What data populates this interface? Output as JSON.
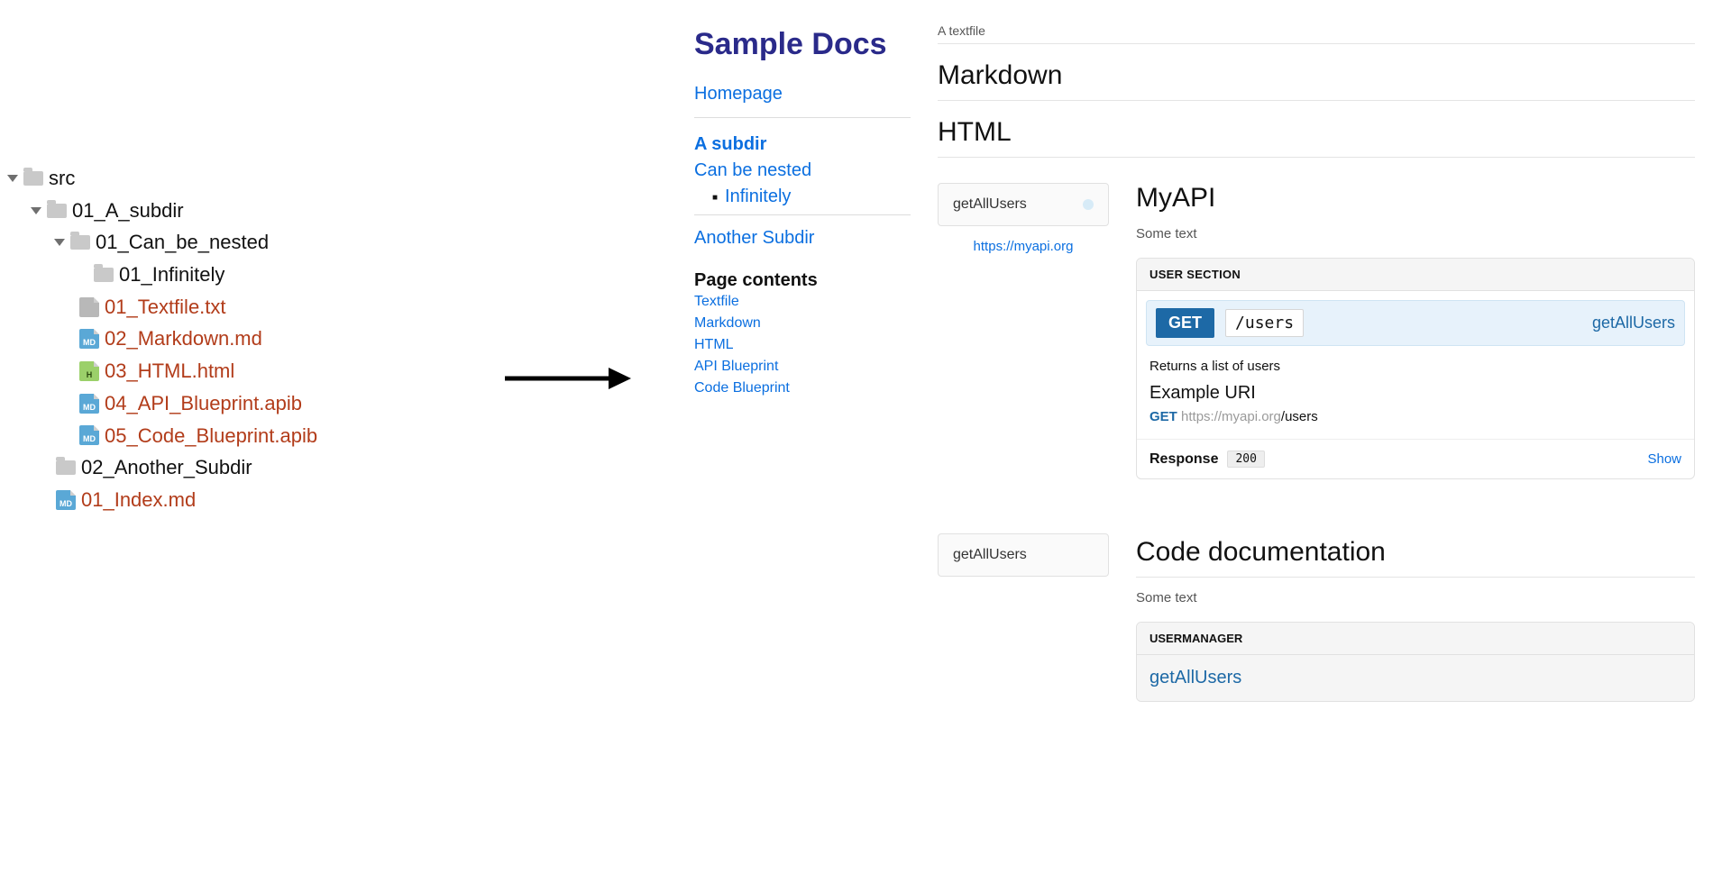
{
  "filetree": {
    "root": "src",
    "subdir": "01_A_subdir",
    "nested": "01_Can_be_nested",
    "infinitely": "01_Infinitely",
    "files_nested": [
      {
        "name": "01_Textfile.txt",
        "chip": "TXT",
        "chipClass": "chip-txt"
      },
      {
        "name": "02_Markdown.md",
        "chip": "MD",
        "chipClass": "chip-md"
      },
      {
        "name": "03_HTML.html",
        "chip": "H",
        "chipClass": "chip-html"
      },
      {
        "name": "04_API_Blueprint.apib",
        "chip": "MD",
        "chipClass": "chip-md"
      },
      {
        "name": "05_Code_Blueprint.apib",
        "chip": "MD",
        "chipClass": "chip-md"
      }
    ],
    "another": "02_Another_Subdir",
    "index": {
      "name": "01_Index.md",
      "chip": "MD",
      "chipClass": "chip-md"
    }
  },
  "site": {
    "title": "Sample Docs",
    "nav": {
      "homepage": "Homepage",
      "subdir_head": "A subdir",
      "can_be_nested": "Can be nested",
      "infinitely": "Infinitely",
      "another": "Another Subdir"
    },
    "page_contents_head": "Page contents",
    "page_contents": [
      "Textfile",
      "Markdown",
      "HTML",
      "API Blueprint",
      "Code Blueprint"
    ]
  },
  "content": {
    "crumb": "A textfile",
    "sections": {
      "markdown": "Markdown",
      "html": "HTML"
    },
    "api": {
      "nav_label": "getAllUsers",
      "host_link": "https://myapi.org",
      "title": "MyAPI",
      "intro": "Some text",
      "section_name": "USER SECTION",
      "verb": "GET",
      "path": "/users",
      "op": "getAllUsers",
      "desc": "Returns a list of users",
      "example_head": "Example URI",
      "example_verb": "GET",
      "example_host": "https://myapi.org",
      "example_path": "/users",
      "response_label": "Response",
      "response_code": "200",
      "show": "Show"
    },
    "code": {
      "nav_label": "getAllUsers",
      "title": "Code documentation",
      "intro": "Some text",
      "section_name": "USERMANAGER",
      "row": "getAllUsers"
    }
  }
}
